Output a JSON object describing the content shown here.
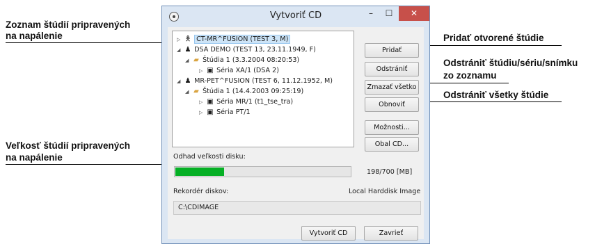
{
  "window": {
    "title": "Vytvoriť CD",
    "controls": {
      "minimize": "–",
      "maximize": "☐",
      "close": "✕"
    }
  },
  "tree": {
    "items": [
      {
        "label": "CT-MR^FUSION (TEST 3, M)",
        "selected": true
      },
      {
        "label": "DSA DEMO (TEST 13, 23.11.1949, F)"
      },
      {
        "label": "Štúdia 1 (3.3.2004 08:20:53)"
      },
      {
        "label": "Séria XA/1 (DSA 2)"
      },
      {
        "label": "MR-PET^FUSION (TEST 6, 11.12.1952, M)"
      },
      {
        "label": "Štúdia 1 (14.4.2003 09:25:19)"
      },
      {
        "label": "Séria MR/1 (t1_tse_tra)"
      },
      {
        "label": "Séria PT/1"
      }
    ]
  },
  "buttons": {
    "add": "Pridať",
    "remove": "Odstrániť",
    "clear_all": "Zmazať všetko",
    "refresh": "Obnoviť",
    "options": "Možnosti...",
    "cover": "Obal CD..."
  },
  "disk": {
    "estimate_label": "Odhad veľkosti disku:",
    "size_text": "198/700 [MB]",
    "fill_fraction": 0.283
  },
  "recorder": {
    "label": "Rekordér diskov:",
    "type": "Local Harddisk Image",
    "path": "C:\\CDIMAGE"
  },
  "footer": {
    "create": "Vytvoriť CD",
    "close": "Zavrieť"
  },
  "callouts": {
    "studies_ready_l1": "Zoznam štúdií pripravených",
    "studies_ready_l2": "na napálenie",
    "size_l1": "Veľkosť štúdií pripravených",
    "size_l2": "na napálenie",
    "add_open": "Pridať otvorené štúdie",
    "remove_l1": "Odstrániť štúdiu/sériu/snímku",
    "remove_l2": "zo zoznamu",
    "remove_all": "Odstrániť všetky štúdie"
  }
}
